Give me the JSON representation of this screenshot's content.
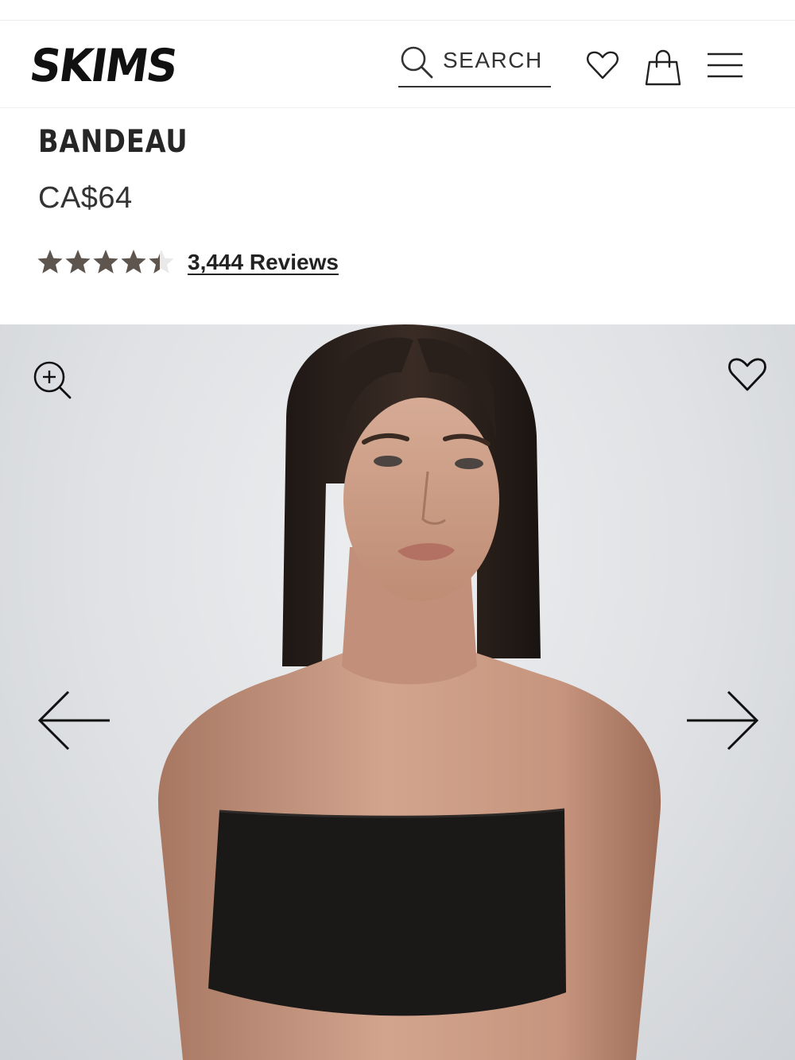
{
  "header": {
    "logo_text": "SKIMS",
    "search_label": "SEARCH"
  },
  "icons": {
    "search": "search-icon",
    "wishlist": "heart-icon",
    "cart": "shopping-bag-icon",
    "menu": "hamburger-menu-icon",
    "zoom": "zoom-in-icon",
    "prev": "arrow-left-icon",
    "next": "arrow-right-icon"
  },
  "product": {
    "title": "BANDEAU",
    "price": "CA$64",
    "rating": 4.5,
    "rating_max": 5,
    "reviews_label": "3,444 Reviews"
  },
  "colors": {
    "star_filled": "#5e554f",
    "star_empty": "#e9e9e9",
    "text": "#222222"
  }
}
